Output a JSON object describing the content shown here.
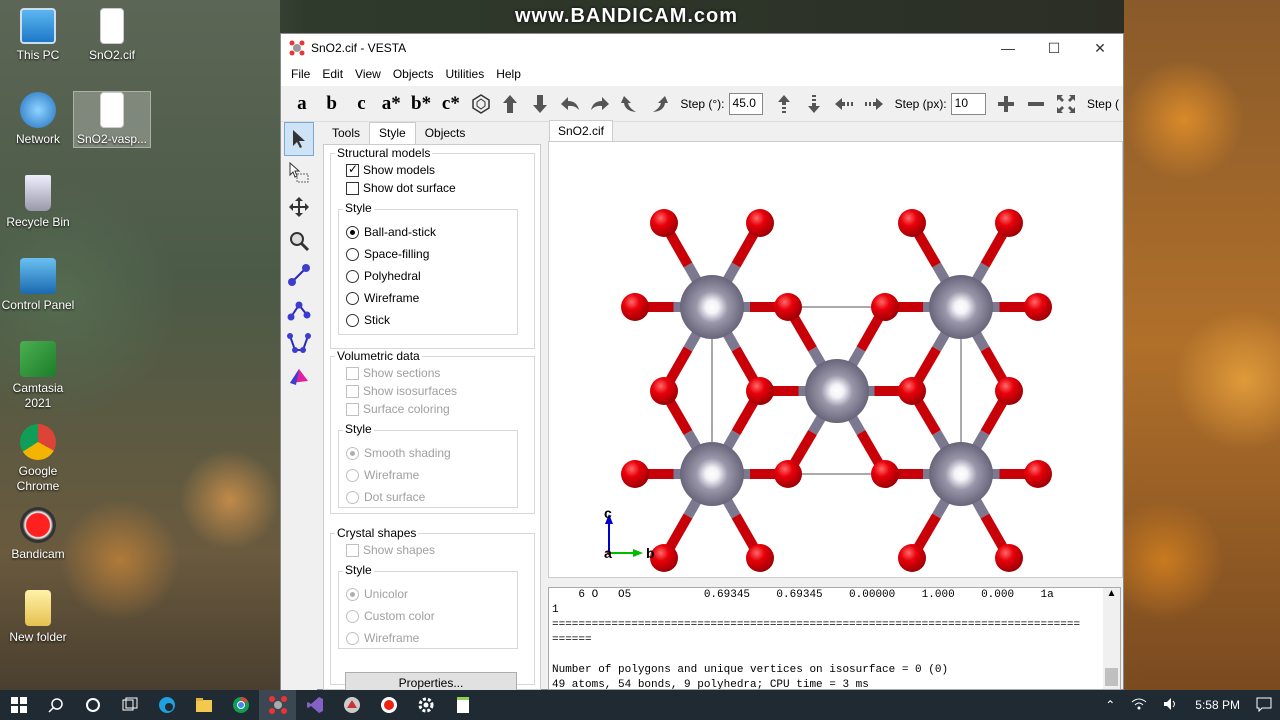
{
  "watermark": "www.BANDICAM.com",
  "desktop_icons": [
    {
      "label": "This PC",
      "icon": "computer-icon"
    },
    {
      "label": "SnO2.cif",
      "icon": "file-icon"
    },
    {
      "label": "Network",
      "icon": "network-icon"
    },
    {
      "label": "SnO2-vasp...",
      "icon": "file-icon"
    },
    {
      "label": "Recycle Bin",
      "icon": "recycle-bin-icon"
    },
    {
      "label": "Control Panel",
      "icon": "control-panel-icon"
    },
    {
      "label": "Camtasia 2021",
      "icon": "camtasia-icon"
    },
    {
      "label": "Google Chrome",
      "icon": "chrome-icon"
    },
    {
      "label": "Bandicam",
      "icon": "bandicam-icon"
    },
    {
      "label": "New folder",
      "icon": "folder-icon"
    }
  ],
  "window": {
    "title": "SnO2.cif - VESTA",
    "menu": [
      "File",
      "Edit",
      "View",
      "Objects",
      "Utilities",
      "Help"
    ],
    "toolbar": {
      "axes": [
        "a",
        "b",
        "c",
        "a*",
        "b*",
        "c*"
      ],
      "step_deg_label": "Step (°):",
      "step_deg_value": "45.0",
      "step_px_label": "Step (px):",
      "step_px_value": "10",
      "step3_label": "Step ("
    },
    "panel": {
      "tabs": [
        "Tools",
        "Style",
        "Objects"
      ],
      "active_tab": "Style",
      "structural": {
        "title": "Structural models",
        "show_models": "Show models",
        "show_dot_surface": "Show dot surface",
        "style_title": "Style",
        "styles": [
          "Ball-and-stick",
          "Space-filling",
          "Polyhedral",
          "Wireframe",
          "Stick"
        ],
        "selected": "Ball-and-stick"
      },
      "volumetric": {
        "title": "Volumetric data",
        "options": [
          "Show sections",
          "Show isosurfaces",
          "Surface coloring"
        ],
        "style_title": "Style",
        "styles": [
          "Smooth shading",
          "Wireframe",
          "Dot surface"
        ]
      },
      "crystal": {
        "title": "Crystal shapes",
        "option": "Show shapes",
        "style_title": "Style",
        "styles": [
          "Unicolor",
          "Custom color",
          "Wireframe"
        ]
      },
      "properties_button": "Properties..."
    },
    "view_tab": "SnO2.cif",
    "axis_labels": {
      "c": "c",
      "a": "a",
      "b": "b"
    },
    "colors": {
      "tin": "#8a8799",
      "oxygen": "#e8000a",
      "bond_o": "#c80008",
      "bond_sn": "#7b7890"
    },
    "console_lines": [
      "    6 O   O5           0.69345    0.69345    0.00000    1.000    0.000    1a",
      "1",
      "================================================================================",
      "======",
      "",
      "Number of polygons and unique vertices on isosurface = 0 (0)",
      "49 atoms, 54 bonds, 9 polyhedra; CPU time = 3 ms"
    ]
  },
  "taskbar": {
    "time": "5:58 PM"
  }
}
